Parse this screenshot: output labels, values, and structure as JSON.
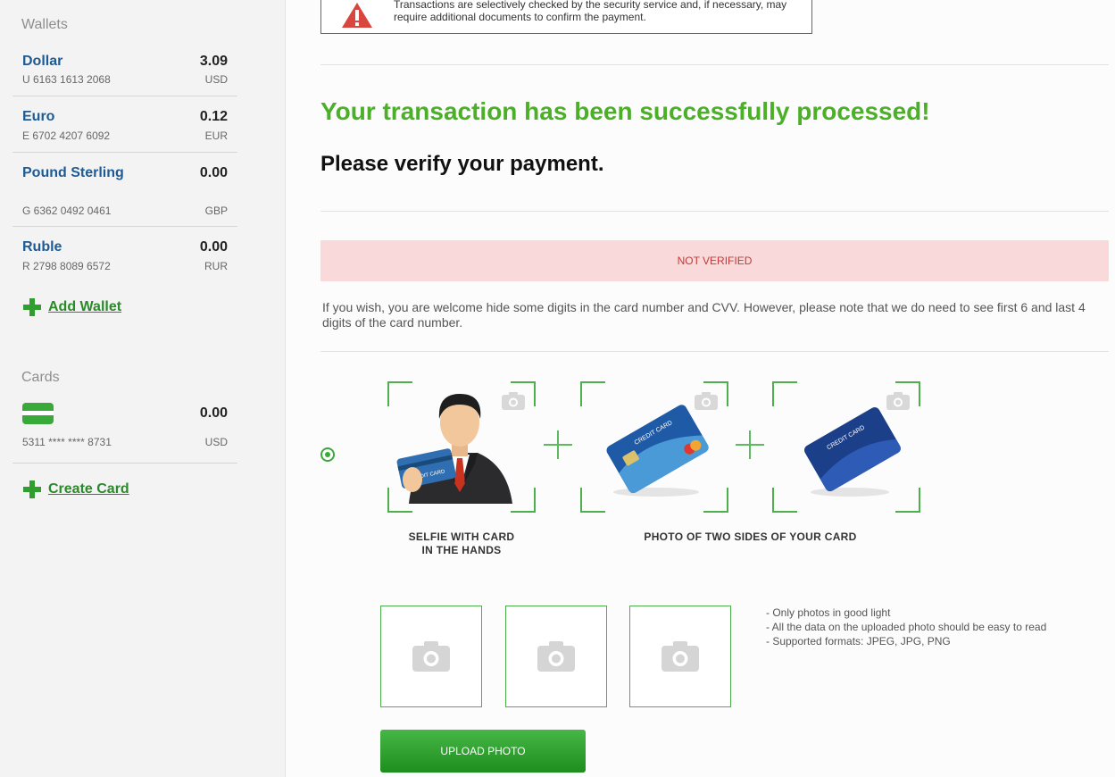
{
  "sidebar": {
    "wallets_title": "Wallets",
    "wallets": [
      {
        "name": "Dollar",
        "number": "U 6163 1613 2068",
        "balance": "3.09",
        "currency": "USD"
      },
      {
        "name": "Euro",
        "number": "E 6702 4207 6092",
        "balance": "0.12",
        "currency": "EUR"
      },
      {
        "name": "Pound Sterling",
        "number": "G 6362 0492 0461",
        "balance": "0.00",
        "currency": "GBP"
      },
      {
        "name": "Ruble",
        "number": "R 2798 8089 6572",
        "balance": "0.00",
        "currency": "RUR"
      }
    ],
    "add_wallet_label": "Add Wallet",
    "cards_title": "Cards",
    "card": {
      "balance": "0.00",
      "number": "5311 **** **** 8731",
      "currency": "USD"
    },
    "create_card_label": "Create Card"
  },
  "main": {
    "warning_text": "Transactions are selectively checked by the security service and, if necessary, may require additional documents to confirm the payment.",
    "success_title": "Your transaction has been successfully processed!",
    "verify_title": "Please verify your payment.",
    "status": "NOT VERIFIED",
    "info_text": "If you wish, you are welcome hide some digits in the card number and CVV. However, please note that we do need to see first 6 and last 4 digits of the card number.",
    "card_label": "CREDIT CARD",
    "caption_selfie_1": "SELFIE WITH CARD",
    "caption_selfie_2": "IN THE HANDS",
    "caption_card": "PHOTO OF TWO SIDES OF YOUR CARD",
    "rules": [
      "- Only photos in good light",
      "- All the data on the uploaded photo should be easy to read",
      "- Supported formats: JPEG, JPG, PNG"
    ],
    "upload_label": "UPLOAD PHOTO"
  },
  "colors": {
    "success": "#4caf28",
    "link": "#1e5b94",
    "alert": "#c23a3a",
    "banner": "#f9d9d9",
    "accent": "#3aa83a"
  }
}
